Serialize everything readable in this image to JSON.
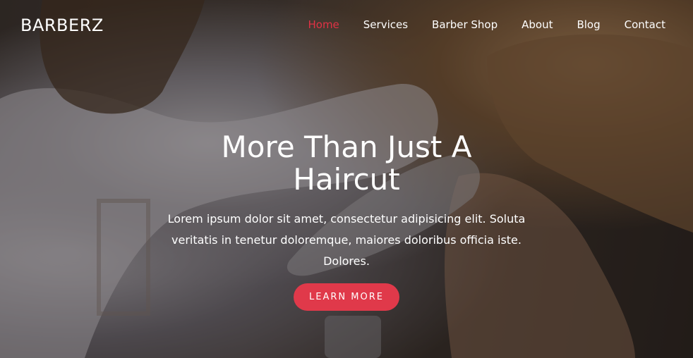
{
  "navbar": {
    "brand": "BARBERZ",
    "links": [
      {
        "label": "Home",
        "active": true
      },
      {
        "label": "Services",
        "active": false
      },
      {
        "label": "Barber Shop",
        "active": false
      },
      {
        "label": "About",
        "active": false
      },
      {
        "label": "Blog",
        "active": false
      },
      {
        "label": "Contact",
        "active": false
      }
    ]
  },
  "hero": {
    "title": "More Than Just A Haircut",
    "text": "Lorem ipsum dolor sit amet, consectetur adipisicing elit. Soluta veritatis in tenetur doloremque, maiores doloribus officia iste. Dolores.",
    "cta_label": "LEARN MORE",
    "image_subject": "barber-trimming-hair-photo"
  },
  "colors": {
    "accent": "#e0394a",
    "active_link": "#e03245",
    "text": "#ffffff"
  }
}
